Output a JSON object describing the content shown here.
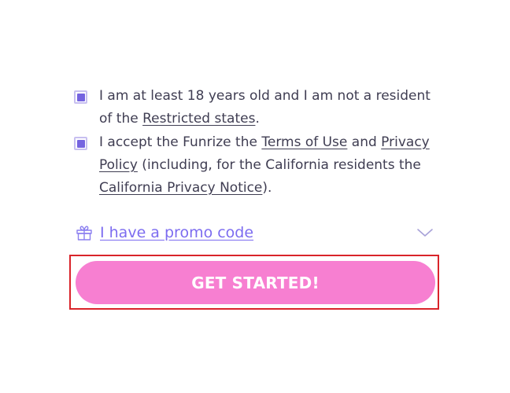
{
  "consent": {
    "age": {
      "checked": true,
      "text_before": "I am at least 18 years old and I am not a resident of the ",
      "link": "Restricted states",
      "text_after": "."
    },
    "terms": {
      "checked": true,
      "text_1": "I accept the Funrize the ",
      "link_terms": "Terms of Use",
      "text_2": " and ",
      "link_privacy": "Privacy Policy",
      "text_3": " (including, for the California residents the ",
      "link_california": "California Privacy Notice",
      "text_4": ")."
    }
  },
  "promo": {
    "label": "I have a promo code",
    "icon": "gift-icon",
    "toggle_icon": "chevron-down-icon"
  },
  "cta": {
    "label": "GET STARTED!"
  },
  "colors": {
    "accent": "#7564e0",
    "promo_link": "#7c6cf0",
    "button_bg": "#f77fd1",
    "highlight": "#d9242a"
  }
}
